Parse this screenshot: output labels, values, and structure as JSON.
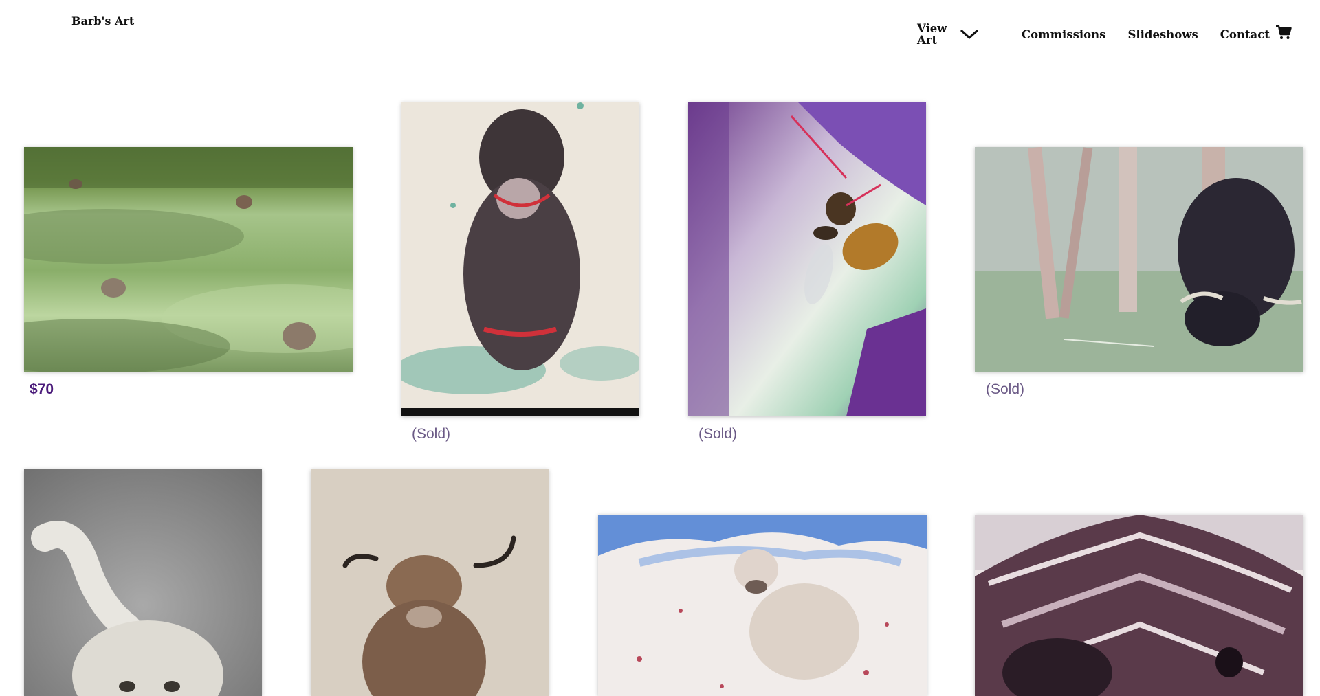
{
  "header": {
    "site_title": "Barb's Art",
    "nav": {
      "view_art": "View Art",
      "commissions": "Commissions",
      "slideshows": "Slideshows",
      "contact": "Contact"
    }
  },
  "gallery": {
    "items": [
      {
        "subject": "highland cattle grazing in green field",
        "caption": "$70"
      },
      {
        "subject": "curly black dog with red collar",
        "caption": "(Sold)"
      },
      {
        "subject": "honey bee on purple flower",
        "caption": "(Sold)"
      },
      {
        "subject": "black highland cow grazing by trees",
        "caption": "(Sold)"
      },
      {
        "subject": "white shaggy dog on grey background",
        "caption": ""
      },
      {
        "subject": "brown highland bull with horns",
        "caption": ""
      },
      {
        "subject": "white calf with blue sky and red splatter",
        "caption": ""
      },
      {
        "subject": "close-up of dark highland cow face",
        "caption": ""
      }
    ]
  },
  "colors": {
    "price": "#4a1a7a",
    "sold": "#6b5a86"
  }
}
